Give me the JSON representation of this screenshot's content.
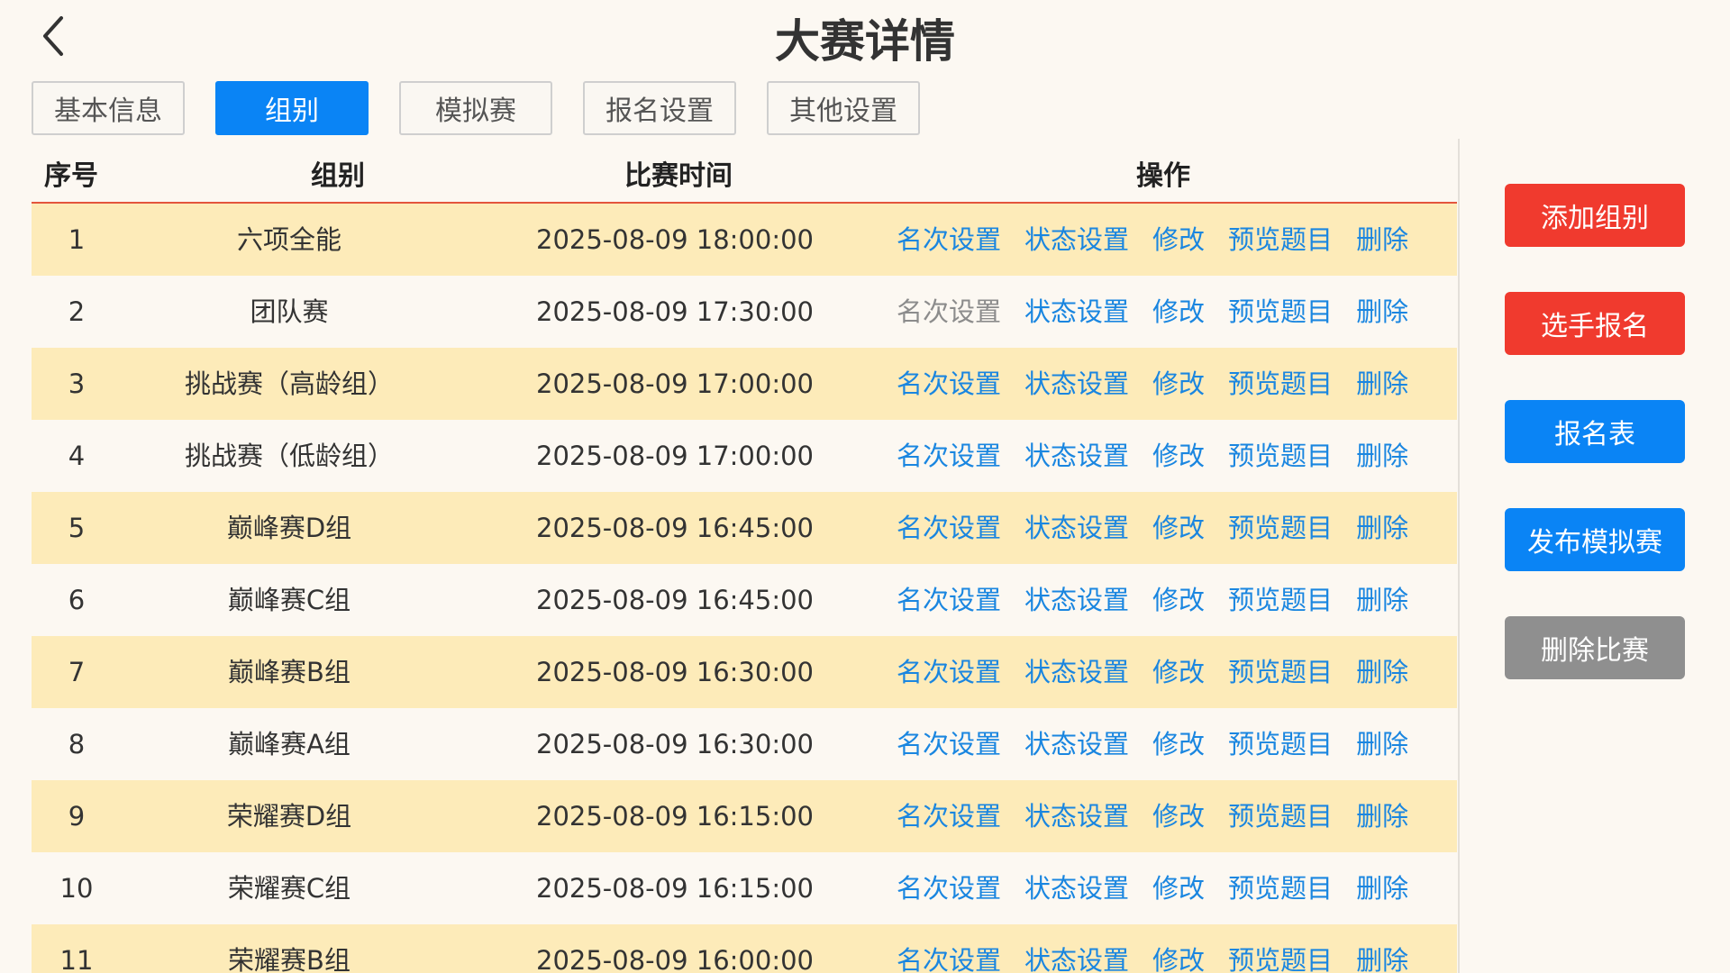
{
  "header": {
    "title": "大赛详情",
    "back_icon": "chevron-left-icon"
  },
  "tabs": [
    {
      "label": "基本信息",
      "active": false
    },
    {
      "label": "组别",
      "active": true
    },
    {
      "label": "模拟赛",
      "active": false
    },
    {
      "label": "报名设置",
      "active": false
    },
    {
      "label": "其他设置",
      "active": false
    }
  ],
  "table": {
    "headers": {
      "index": "序号",
      "group": "组别",
      "time": "比赛时间",
      "ops": "操作"
    },
    "op_labels": {
      "rank": "名次设置",
      "status": "状态设置",
      "edit": "修改",
      "preview": "预览题目",
      "delete": "删除"
    },
    "rows": [
      {
        "index": "1",
        "group": "六项全能",
        "time": "2025-08-09 18:00:00",
        "rank_disabled": false
      },
      {
        "index": "2",
        "group": "团队赛",
        "time": "2025-08-09 17:30:00",
        "rank_disabled": true
      },
      {
        "index": "3",
        "group": "挑战赛（高龄组）",
        "time": "2025-08-09 17:00:00",
        "rank_disabled": false
      },
      {
        "index": "4",
        "group": "挑战赛（低龄组）",
        "time": "2025-08-09 17:00:00",
        "rank_disabled": false
      },
      {
        "index": "5",
        "group": "巅峰赛D组",
        "time": "2025-08-09 16:45:00",
        "rank_disabled": false
      },
      {
        "index": "6",
        "group": "巅峰赛C组",
        "time": "2025-08-09 16:45:00",
        "rank_disabled": false
      },
      {
        "index": "7",
        "group": "巅峰赛B组",
        "time": "2025-08-09 16:30:00",
        "rank_disabled": false
      },
      {
        "index": "8",
        "group": "巅峰赛A组",
        "time": "2025-08-09 16:30:00",
        "rank_disabled": false
      },
      {
        "index": "9",
        "group": "荣耀赛D组",
        "time": "2025-08-09 16:15:00",
        "rank_disabled": false
      },
      {
        "index": "10",
        "group": "荣耀赛C组",
        "time": "2025-08-09 16:15:00",
        "rank_disabled": false
      },
      {
        "index": "11",
        "group": "荣耀赛B组",
        "time": "2025-08-09 16:00:00",
        "rank_disabled": false
      }
    ]
  },
  "sidebar": {
    "buttons": [
      {
        "name": "add-group-button",
        "label": "添加组别",
        "color": "red"
      },
      {
        "name": "player-signup-button",
        "label": "选手报名",
        "color": "red"
      },
      {
        "name": "signup-sheet-button",
        "label": "报名表",
        "color": "blue"
      },
      {
        "name": "publish-mock-button",
        "label": "发布模拟赛",
        "color": "blue"
      },
      {
        "name": "delete-contest-button",
        "label": "删除比赛",
        "color": "gray"
      }
    ]
  },
  "colors": {
    "accent": "#0a84f5",
    "danger": "#f03a2e",
    "neutral": "#8f8f8f",
    "link": "#1a86e0",
    "row_highlight": "#fdebb9",
    "header_rule": "#e3553d"
  }
}
